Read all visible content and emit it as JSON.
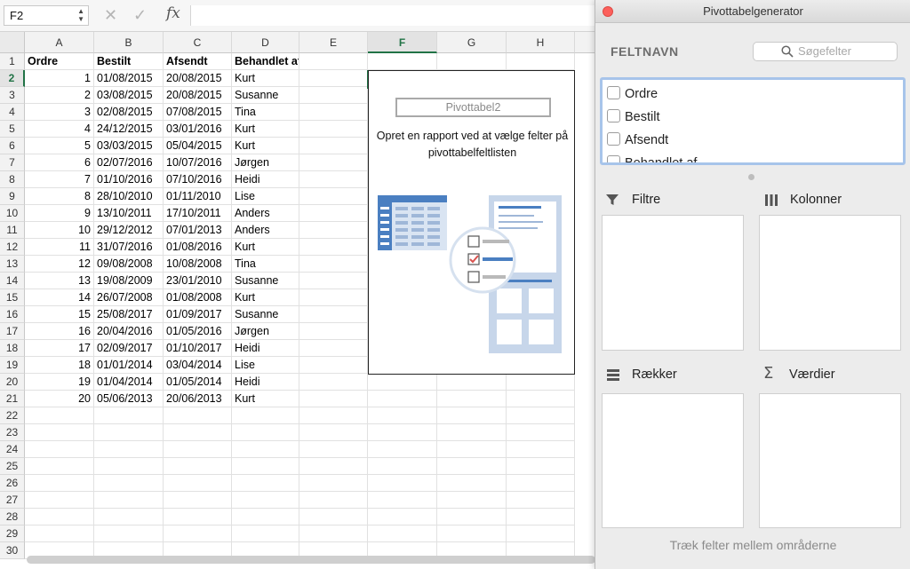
{
  "formula_bar": {
    "name_box": "F2",
    "cancel_icon": "x-icon",
    "confirm_icon": "check-icon",
    "function_icon": "fx",
    "formula": ""
  },
  "sheet": {
    "columns": [
      "A",
      "B",
      "C",
      "D",
      "E",
      "F",
      "G",
      "H"
    ],
    "selected_column": "F",
    "selected_row": "2",
    "rows": [
      "1",
      "2",
      "3",
      "4",
      "5",
      "6",
      "7",
      "8",
      "9",
      "10",
      "11",
      "12",
      "13",
      "14",
      "15",
      "16",
      "17",
      "18",
      "19",
      "20",
      "21",
      "22",
      "23",
      "24",
      "25",
      "26",
      "27",
      "28",
      "29",
      "30"
    ],
    "headers": [
      "Ordre",
      "Bestilt",
      "Afsendt",
      "Behandlet af"
    ],
    "data": [
      [
        "1",
        "01/08/2015",
        "20/08/2015",
        "Kurt"
      ],
      [
        "2",
        "03/08/2015",
        "20/08/2015",
        "Susanne"
      ],
      [
        "3",
        "02/08/2015",
        "07/08/2015",
        "Tina"
      ],
      [
        "4",
        "24/12/2015",
        "03/01/2016",
        "Kurt"
      ],
      [
        "5",
        "03/03/2015",
        "05/04/2015",
        "Kurt"
      ],
      [
        "6",
        "02/07/2016",
        "10/07/2016",
        "Jørgen"
      ],
      [
        "7",
        "01/10/2016",
        "07/10/2016",
        "Heidi"
      ],
      [
        "8",
        "28/10/2010",
        "01/11/2010",
        "Lise"
      ],
      [
        "9",
        "13/10/2011",
        "17/10/2011",
        "Anders"
      ],
      [
        "10",
        "29/12/2012",
        "07/01/2013",
        "Anders"
      ],
      [
        "11",
        "31/07/2016",
        "01/08/2016",
        "Kurt"
      ],
      [
        "12",
        "09/08/2008",
        "10/08/2008",
        "Tina"
      ],
      [
        "13",
        "19/08/2009",
        "23/01/2010",
        "Susanne"
      ],
      [
        "14",
        "26/07/2008",
        "01/08/2008",
        "Kurt"
      ],
      [
        "15",
        "25/08/2017",
        "01/09/2017",
        "Susanne"
      ],
      [
        "16",
        "20/04/2016",
        "01/05/2016",
        "Jørgen"
      ],
      [
        "17",
        "02/09/2017",
        "01/10/2017",
        "Heidi"
      ],
      [
        "18",
        "01/01/2014",
        "03/04/2014",
        "Lise"
      ],
      [
        "19",
        "01/04/2014",
        "01/05/2014",
        "Heidi"
      ],
      [
        "20",
        "05/06/2013",
        "20/06/2013",
        "Kurt"
      ]
    ]
  },
  "pivot_placeholder": {
    "name": "Pivottabel2",
    "instructions": "Opret en rapport ved at vælge felter på pivottabelfeltlisten"
  },
  "panel": {
    "title": "Pivottabelgenerator",
    "field_heading": "FELTNAVN",
    "search_placeholder": "Søgefelter",
    "fields": [
      "Ordre",
      "Bestilt",
      "Afsendt",
      "Behandlet af"
    ],
    "areas": {
      "filters": "Filtre",
      "columns": "Kolonner",
      "rows": "Rækker",
      "values": "Værdier"
    },
    "footer": "Træk felter mellem områderne"
  },
  "colors": {
    "accent": "#217346",
    "close_button": "#fc605c",
    "field_list_border": "#a7c4ea",
    "illustration_blue": "#4a7fc1"
  }
}
